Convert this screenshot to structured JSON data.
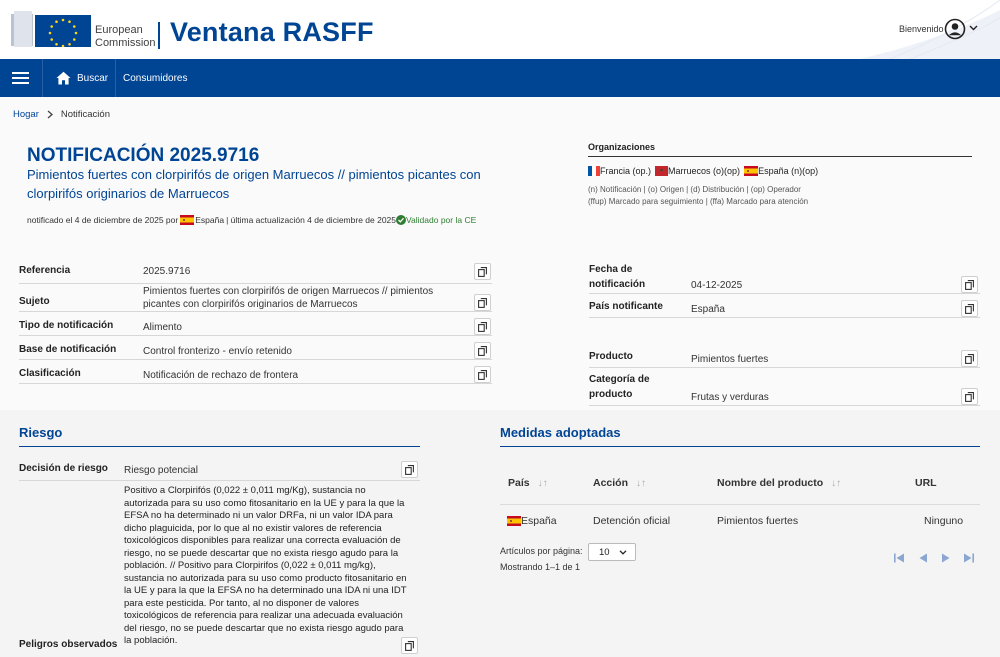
{
  "header": {
    "brand_line1": "European",
    "brand_line2": "Commission",
    "app_title": "Ventana RASFF",
    "welcome": "Bienvenido"
  },
  "nav": {
    "search_label": "Buscar",
    "consumers_label": "Consumidores"
  },
  "breadcrumb": {
    "home": "Hogar",
    "current": "Notificación"
  },
  "notification": {
    "title": "NOTIFICACIÓN 2025.9716",
    "subtitle": "Pimientos fuertes con clorpirifós de origen Marruecos // pimientos picantes con clorpirifós originarios de Marruecos",
    "meta_notified": "notificado el 4 de diciembre de 2025 por",
    "meta_country": "España",
    "meta_updated": "| última actualización 4 de diciembre de 2025",
    "meta_validated": "Validado por la CE"
  },
  "organizations": {
    "title": "Organizaciones",
    "items": [
      {
        "label": "Francia (op.)",
        "flag": "fr"
      },
      {
        "label": "Marruecos (o)(op)",
        "flag": "ma"
      },
      {
        "label": "España (n)(op)",
        "flag": "es"
      }
    ],
    "legend_line1": "(n) Notificación | (o) Origen | (d) Distribución | (op) Operador",
    "legend_line2": "(ffup) Marcado para seguimiento | (ffa) Marcado para atención"
  },
  "details_left": [
    {
      "label": "Referencia",
      "value": "2025.9716"
    },
    {
      "label": "Sujeto",
      "value": "Pimientos fuertes con clorpirifós de origen Marruecos // pimientos picantes con clorpirifós originarios de Marruecos"
    },
    {
      "label": "Tipo de notificación",
      "value": "Alimento"
    },
    {
      "label": "Base de notificación",
      "value": "Control fronterizo - envío retenido"
    },
    {
      "label": "Clasificación",
      "value": "Notificación de rechazo de frontera"
    }
  ],
  "details_right": [
    {
      "label_line1": "Fecha de",
      "label_line2": "notificación",
      "value": "04-12-2025"
    },
    {
      "label": "País notificante",
      "value": "España"
    },
    {
      "label": "Producto",
      "value": "Pimientos fuertes"
    },
    {
      "label_line1": "Categoría de",
      "label_line2": "producto",
      "value": "Frutas y verduras"
    }
  ],
  "risk": {
    "title": "Riesgo",
    "decision_label": "Decisión de riesgo",
    "decision_value": "Riesgo potencial",
    "hazards_label": "Peligros observados",
    "hazards_text": "Positivo a Clorpirifós (0,022 ± 0,011 mg/Kg), sustancia no autorizada para su uso como fitosanitario en la UE y para la que la EFSA no ha determinado ni un valor DRFa, ni un valor IDA para dicho plaguicida, por lo que al no existir valores de referencia toxicológicos disponibles para realizar una correcta evaluación de riesgo, no se puede descartar que no exista riesgo agudo para la población. // Positivo para Clorpirifos (0,022 ± 0,011 mg/kg), sustancia no autorizada para su uso como producto fitosanitario en la UE y para la que la EFSA no ha determinado una IDA ni una IDT para este pesticida. Por tanto, al no disponer de valores toxicológicos de referencia para realizar una adecuada evaluación del riesgo, no se puede descartar que no exista riesgo agudo para la población."
  },
  "measures": {
    "title": "Medidas adoptadas",
    "columns": [
      "País",
      "Acción",
      "Nombre del producto",
      "URL"
    ],
    "rows": [
      {
        "country": "España",
        "action": "Detención oficial",
        "product": "Pimientos fuertes",
        "url": "Ninguno"
      }
    ],
    "per_page_label": "Artículos por página:",
    "per_page_value": "10",
    "showing": "Mostrando 1–1 de 1"
  }
}
